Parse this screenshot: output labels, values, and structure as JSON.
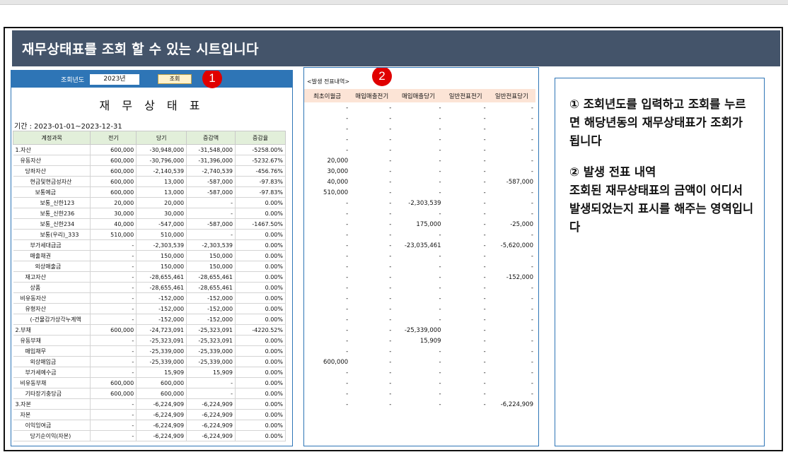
{
  "banner_title": "재무상태표를 조회 할 수 있는 시트입니다",
  "query": {
    "label": "조회년도",
    "year": "2023년",
    "button": "조회"
  },
  "badges": {
    "one": "1",
    "two": "2"
  },
  "report_title": "재 무 상 태 표",
  "period": "기간 : 2023-01-01~2023-12-31",
  "left_columns": [
    "계정과목",
    "전기",
    "당기",
    "증감액",
    "증감율"
  ],
  "left_rows": [
    {
      "name": "1.자산",
      "indent": 0,
      "prev": "600,000",
      "curr": "-30,948,000",
      "diff": "-31,548,000",
      "rate": "-5258.00%"
    },
    {
      "name": "유동자산",
      "indent": 1,
      "prev": "600,000",
      "curr": "-30,796,000",
      "diff": "-31,396,000",
      "rate": "-5232.67%"
    },
    {
      "name": "당좌자산",
      "indent": 2,
      "prev": "600,000",
      "curr": "-2,140,539",
      "diff": "-2,740,539",
      "rate": "-456.76%"
    },
    {
      "name": "현금및현금성자산",
      "indent": 3,
      "prev": "600,000",
      "curr": "13,000",
      "diff": "-587,000",
      "rate": "-97.83%"
    },
    {
      "name": "보통예금",
      "indent": 4,
      "prev": "600,000",
      "curr": "13,000",
      "diff": "-587,000",
      "rate": "-97.83%"
    },
    {
      "name": "보통_신한123",
      "indent": 5,
      "prev": "20,000",
      "curr": "20,000",
      "diff": "-",
      "rate": "0.00%"
    },
    {
      "name": "보통_신한236",
      "indent": 5,
      "prev": "30,000",
      "curr": "30,000",
      "diff": "-",
      "rate": "0.00%"
    },
    {
      "name": "보통_신한234",
      "indent": 5,
      "prev": "40,000",
      "curr": "-547,000",
      "diff": "-587,000",
      "rate": "-1467.50%"
    },
    {
      "name": "보통(우리)_333",
      "indent": 5,
      "prev": "510,000",
      "curr": "510,000",
      "diff": "-",
      "rate": "0.00%"
    },
    {
      "name": "부가세대급금",
      "indent": 3,
      "prev": "-",
      "curr": "-2,303,539",
      "diff": "-2,303,539",
      "rate": "0.00%"
    },
    {
      "name": "매출채권",
      "indent": 3,
      "prev": "-",
      "curr": "150,000",
      "diff": "150,000",
      "rate": "0.00%"
    },
    {
      "name": "외상매출금",
      "indent": 4,
      "prev": "-",
      "curr": "150,000",
      "diff": "150,000",
      "rate": "0.00%"
    },
    {
      "name": "재고자산",
      "indent": 2,
      "prev": "-",
      "curr": "-28,655,461",
      "diff": "-28,655,461",
      "rate": "0.00%"
    },
    {
      "name": "상품",
      "indent": 3,
      "prev": "-",
      "curr": "-28,655,461",
      "diff": "-28,655,461",
      "rate": "0.00%"
    },
    {
      "name": "비유동자산",
      "indent": 1,
      "prev": "-",
      "curr": "-152,000",
      "diff": "-152,000",
      "rate": "0.00%"
    },
    {
      "name": "유형자산",
      "indent": 2,
      "prev": "-",
      "curr": "-152,000",
      "diff": "-152,000",
      "rate": "0.00%"
    },
    {
      "name": "(-건물감가상각누계액",
      "indent": 3,
      "prev": "-",
      "curr": "-152,000",
      "diff": "-152,000",
      "rate": "0.00%"
    },
    {
      "name": "2.부채",
      "indent": 0,
      "prev": "600,000",
      "curr": "-24,723,091",
      "diff": "-25,323,091",
      "rate": "-4220.52%"
    },
    {
      "name": "유동부채",
      "indent": 1,
      "prev": "-",
      "curr": "-25,323,091",
      "diff": "-25,323,091",
      "rate": "0.00%"
    },
    {
      "name": "매입채무",
      "indent": 2,
      "prev": "-",
      "curr": "-25,339,000",
      "diff": "-25,339,000",
      "rate": "0.00%"
    },
    {
      "name": "외상매입금",
      "indent": 3,
      "prev": "-",
      "curr": "-25,339,000",
      "diff": "-25,339,000",
      "rate": "0.00%"
    },
    {
      "name": "부가세예수금",
      "indent": 2,
      "prev": "-",
      "curr": "15,909",
      "diff": "15,909",
      "rate": "0.00%"
    },
    {
      "name": "비유동부채",
      "indent": 1,
      "prev": "600,000",
      "curr": "600,000",
      "diff": "-",
      "rate": "0.00%"
    },
    {
      "name": "기타장기충당금",
      "indent": 2,
      "prev": "600,000",
      "curr": "600,000",
      "diff": "-",
      "rate": "0.00%"
    },
    {
      "name": "3.자본",
      "indent": 0,
      "prev": "-",
      "curr": "-6,224,909",
      "diff": "-6,224,909",
      "rate": "0.00%"
    },
    {
      "name": "자본",
      "indent": 1,
      "prev": "-",
      "curr": "-6,224,909",
      "diff": "-6,224,909",
      "rate": "0.00%"
    },
    {
      "name": "이익잉여금",
      "indent": 2,
      "prev": "-",
      "curr": "-6,224,909",
      "diff": "-6,224,909",
      "rate": "0.00%"
    },
    {
      "name": "당기순이익(자본)",
      "indent": 3,
      "prev": "-",
      "curr": "-6,224,909",
      "diff": "-6,224,909",
      "rate": "0.00%"
    }
  ],
  "mid_label": "<발생 전표내역>",
  "mid_columns": [
    "최초이월금",
    "매입매출전기",
    "매입매출당기",
    "일반전표전기",
    "일반전표당기"
  ],
  "mid_rows": [
    [
      "-",
      "-",
      "-",
      "-",
      "-"
    ],
    [
      "-",
      "-",
      "-",
      "-",
      "-"
    ],
    [
      "-",
      "-",
      "-",
      "-",
      "-"
    ],
    [
      "-",
      "-",
      "-",
      "-",
      "-"
    ],
    [
      "-",
      "-",
      "-",
      "-",
      "-"
    ],
    [
      "20,000",
      "-",
      "-",
      "-",
      "-"
    ],
    [
      "30,000",
      "-",
      "-",
      "-",
      "-"
    ],
    [
      "40,000",
      "-",
      "-",
      "-",
      "-587,000"
    ],
    [
      "510,000",
      "-",
      "-",
      "-",
      "-"
    ],
    [
      "-",
      "-",
      "-2,303,539",
      "-",
      "-"
    ],
    [
      "-",
      "-",
      "-",
      "-",
      "-"
    ],
    [
      "-",
      "-",
      "175,000",
      "-",
      "-25,000"
    ],
    [
      "-",
      "-",
      "-",
      "-",
      "-"
    ],
    [
      "-",
      "-",
      "-23,035,461",
      "-",
      "-5,620,000"
    ],
    [
      "-",
      "-",
      "-",
      "-",
      "-"
    ],
    [
      "-",
      "-",
      "-",
      "-",
      "-"
    ],
    [
      "-",
      "-",
      "-",
      "-",
      "-152,000"
    ],
    [
      "-",
      "-",
      "-",
      "-",
      "-"
    ],
    [
      "-",
      "-",
      "-",
      "-",
      "-"
    ],
    [
      "-",
      "-",
      "-",
      "-",
      "-"
    ],
    [
      "-",
      "-",
      "-",
      "-",
      "-"
    ],
    [
      "-",
      "-",
      "-25,339,000",
      "-",
      "-"
    ],
    [
      "-",
      "-",
      "15,909",
      "-",
      "-"
    ],
    [
      "-",
      "-",
      "-",
      "-",
      "-"
    ],
    [
      "600,000",
      "-",
      "-",
      "-",
      "-"
    ],
    [
      "-",
      "-",
      "-",
      "-",
      "-"
    ],
    [
      "-",
      "-",
      "-",
      "-",
      "-"
    ],
    [
      "-",
      "-",
      "-",
      "-",
      "-"
    ],
    [
      "-",
      "-",
      "-",
      "-",
      "-6,224,909"
    ]
  ],
  "note": {
    "p1": "① 조회년도를 입력하고 조회를 누르면 해당년동의 재무상태표가 조회가 됩니다",
    "p2_title": "② 발생 전표 내역",
    "p2_body": " 조회된 재무상태표의 금액이 어디서 발생되었는지 표시를 해주는 영역입니다"
  }
}
